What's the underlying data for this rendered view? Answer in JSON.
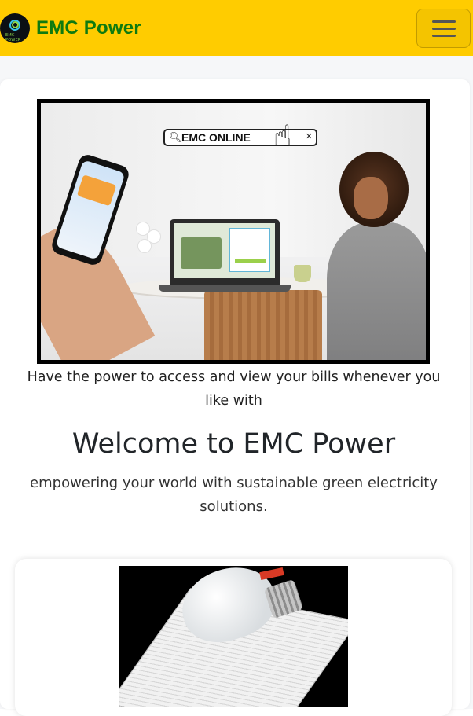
{
  "navbar": {
    "brand_name": "EMC Power",
    "logo_text": "EMC POWER",
    "menu_icon": "hamburger-icon"
  },
  "hero": {
    "image_caption_search_text": "EMC ONLINE",
    "tagline": "Have the power to access and view your bills whenever you like with",
    "welcome": "Welcome to EMC Power",
    "subtitle": "empowering your world with sustainable green electricity solutions."
  },
  "colors": {
    "navbar_bg": "#ffcc00",
    "brand_text": "#0f7a0f",
    "page_bg": "#f6f7f9"
  }
}
